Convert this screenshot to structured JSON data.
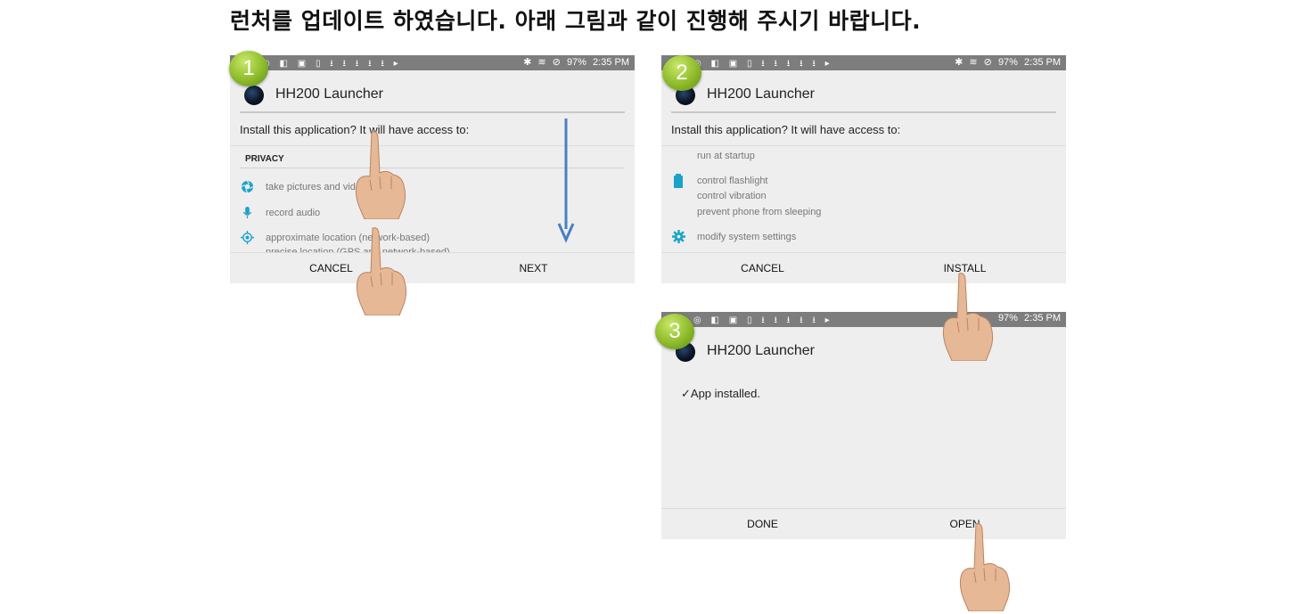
{
  "title": "런처를 업데이트 하였습니다. 아래 그림과 같이 진행해 주시기 바랍니다.",
  "status_bar": {
    "battery": "97%",
    "time": "2:35 PM"
  },
  "steps": [
    {
      "badge": "1",
      "app_name": "HH200 Launcher",
      "prompt": "Install this application? It will have access to:",
      "section": "PRIVACY",
      "permissions": [
        {
          "icon": "camera-icon",
          "text": "take pictures and videos"
        },
        {
          "icon": "microphone-icon",
          "text": "record audio"
        },
        {
          "icon": "location-icon",
          "text": "approximate location (network-based)"
        },
        {
          "icon": "",
          "text": "precise location (GPS and network-based)"
        }
      ],
      "buttons": {
        "left": "CANCEL",
        "right": "NEXT"
      }
    },
    {
      "badge": "2",
      "app_name": "HH200 Launcher",
      "prompt": "Install this application? It will have access to:",
      "permissions": [
        {
          "icon": "",
          "text": "run at startup"
        },
        {
          "icon": "battery-icon",
          "text": "control flashlight"
        },
        {
          "icon": "",
          "text": "control vibration"
        },
        {
          "icon": "",
          "text": "prevent phone from sleeping"
        },
        {
          "icon": "gear-icon",
          "text": "modify system settings"
        }
      ],
      "buttons": {
        "left": "CANCEL",
        "right": "INSTALL"
      }
    },
    {
      "badge": "3",
      "app_name": "HH200 Launcher",
      "message": "App installed.",
      "buttons": {
        "left": "DONE",
        "right": "OPEN"
      }
    }
  ],
  "colors": {
    "accent": "#1aa3c9",
    "statusbar": "#7d7d7d",
    "screen_bg": "#eeeeee",
    "badge": "#8dbb2a",
    "arrow": "#4a7fc1"
  }
}
